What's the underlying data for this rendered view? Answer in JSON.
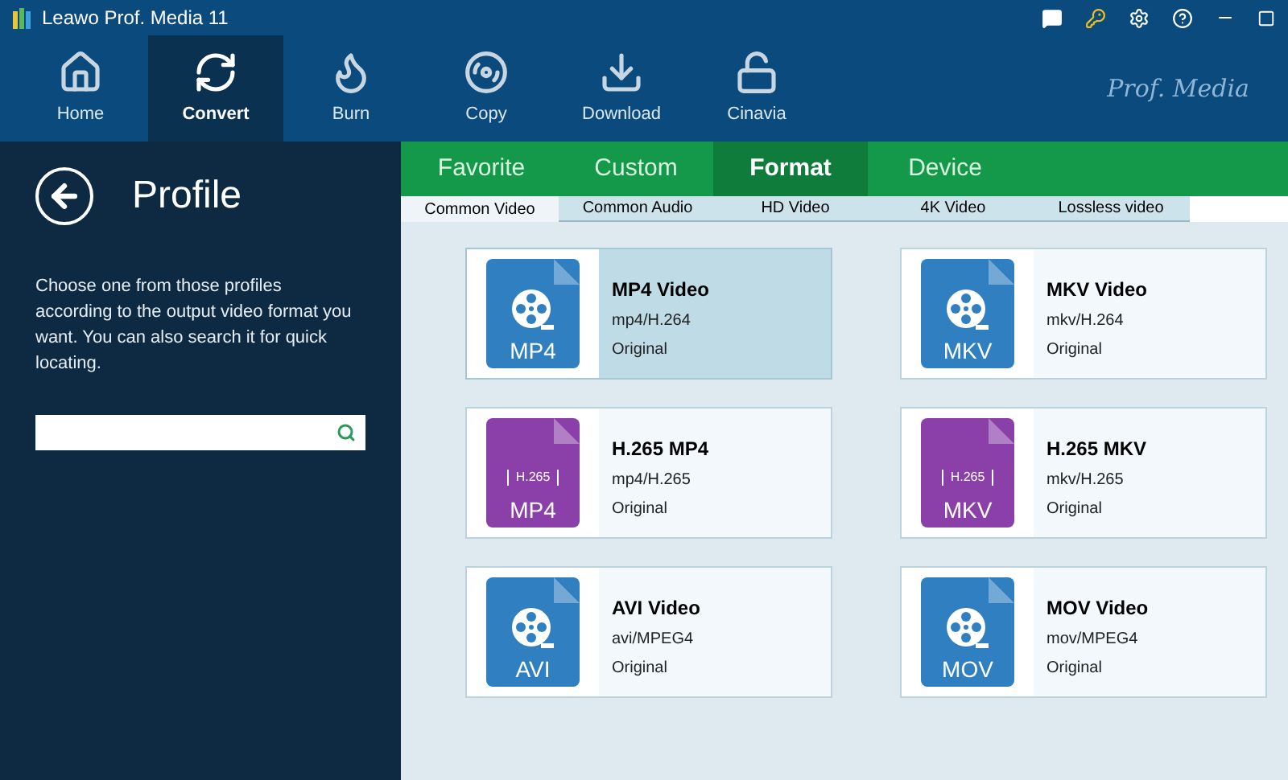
{
  "window": {
    "title": "Leawo Prof. Media 11"
  },
  "toolbar": [
    {
      "label": "Home",
      "selected": false,
      "kind": "home"
    },
    {
      "label": "Convert",
      "selected": true,
      "kind": "convert"
    },
    {
      "label": "Burn",
      "selected": false,
      "kind": "burn"
    },
    {
      "label": "Copy",
      "selected": false,
      "kind": "copy"
    },
    {
      "label": "Download",
      "selected": false,
      "kind": "download"
    },
    {
      "label": "Cinavia",
      "selected": false,
      "kind": "cinavia"
    }
  ],
  "brand": "Prof. Media",
  "sidebar": {
    "title": "Profile",
    "description": "Choose one from those profiles according to the output video format you want. You can also search it for quick locating."
  },
  "tabs": [
    {
      "label": "Favorite",
      "selected": false
    },
    {
      "label": "Custom",
      "selected": false
    },
    {
      "label": "Format",
      "selected": true
    },
    {
      "label": "Device",
      "selected": false
    }
  ],
  "subtabs": [
    {
      "label": "Common Video",
      "selected": true
    },
    {
      "label": "Common Audio",
      "selected": false
    },
    {
      "label": "HD Video",
      "selected": false
    },
    {
      "label": "4K Video",
      "selected": false
    },
    {
      "label": "Lossless video",
      "selected": false
    }
  ],
  "profiles": [
    {
      "name": "MP4 Video",
      "codec": "mp4/H.264",
      "quality": "Original",
      "ext": "MP4",
      "kind": "reel",
      "color": "#2f7fc1",
      "selected": true
    },
    {
      "name": "MKV Video",
      "codec": "mkv/H.264",
      "quality": "Original",
      "ext": "MKV",
      "kind": "reel",
      "color": "#2f7fc1",
      "selected": false
    },
    {
      "name": "H.265 MP4",
      "codec": "mp4/H.265",
      "quality": "Original",
      "ext": "MP4",
      "kind": "codec",
      "badge": "H.265",
      "color": "#8b3fa8",
      "selected": false
    },
    {
      "name": "H.265 MKV",
      "codec": "mkv/H.265",
      "quality": "Original",
      "ext": "MKV",
      "kind": "codec",
      "badge": "H.265",
      "color": "#8b3fa8",
      "selected": false
    },
    {
      "name": "AVI Video",
      "codec": "avi/MPEG4",
      "quality": "Original",
      "ext": "AVI",
      "kind": "reel",
      "color": "#2f7fc1",
      "selected": false
    },
    {
      "name": "MOV Video",
      "codec": "mov/MPEG4",
      "quality": "Original",
      "ext": "MOV",
      "kind": "reel",
      "color": "#2f7fc1",
      "selected": false
    }
  ]
}
